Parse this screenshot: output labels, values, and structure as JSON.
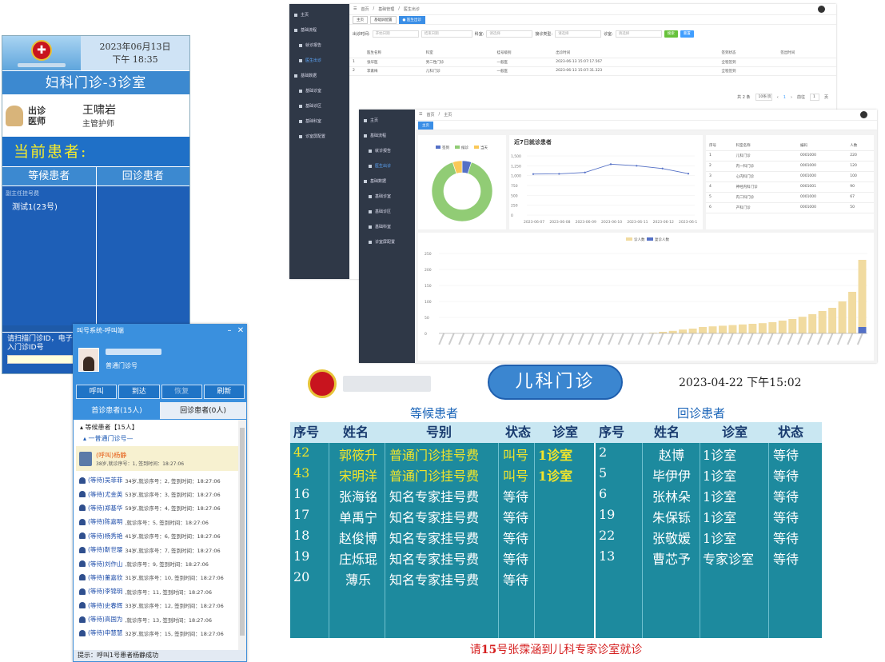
{
  "gyn": {
    "date": "2023年06月13日",
    "time": "下午 18:35",
    "title": "妇科门诊-3诊室",
    "doctor_label1": "出诊",
    "doctor_label2": "医师",
    "doctor_name": "王啸岩",
    "doctor_role": "主管护师",
    "current_label": "当前患者:",
    "waiting_head": "等候患者",
    "recheck_head": "回诊患者",
    "waiting_subtitle": "副主任挂号费",
    "waiting_patient": "测试1(23号)",
    "footer1": "请扫描门诊ID，电子",
    "footer2": "入门诊ID号"
  },
  "call": {
    "title": "叫号系统-呼叫端",
    "user_role": "普通门诊号",
    "buttons": [
      "呼叫",
      "到达",
      "恢复",
      "刷新"
    ],
    "tab_first": "首诊患者(15人)",
    "tab_recheck": "回诊患者(0人)",
    "group": "▴ 等候患者【15人】",
    "subgroup": "▴ 一普通门诊号—",
    "calling_name": "(呼叫)杨静",
    "calling_detail": "38岁,就诊序号：1, 签到时间：18:27:06",
    "rows": [
      {
        "name": "(等待)吴菲菲",
        "detail": "34岁,就诊序号：2, 签到时间：18:27:06"
      },
      {
        "name": "(等待)尤金英",
        "detail": "53岁,就诊序号：3, 签到时间：18:27:06"
      },
      {
        "name": "(等待)郑基华",
        "detail": "59岁,就诊序号：4, 签到时间：18:27:06"
      },
      {
        "name": "(等待)陈嘉明",
        "detail": ",就诊序号：5, 签到时间：18:27:06"
      },
      {
        "name": "(等待)杨秀艳",
        "detail": "41岁,就诊序号：6, 签到时间：18:27:06"
      },
      {
        "name": "(等待)靳世璎",
        "detail": "34岁,就诊序号：7, 签到时间：18:27:06"
      },
      {
        "name": "(等待)刘作山",
        "detail": ",就诊序号：9, 签到时间：18:27:06"
      },
      {
        "name": "(等待)董嘉欣",
        "detail": "31岁,就诊序号：10, 签到时间：18:27:06"
      },
      {
        "name": "(等待)李锦玥",
        "detail": ",就诊序号：11, 签到时间：18:27:06"
      },
      {
        "name": "(等待)史春辉",
        "detail": "33岁,就诊序号：12, 签到时间：18:27:06"
      },
      {
        "name": "(等待)高国为",
        "detail": ",就诊序号：13, 签到时间：18:27:06"
      },
      {
        "name": "(等待)申慧慧",
        "detail": "32岁,就诊序号：15, 签到时间：18:27:06"
      }
    ],
    "status": "提示：呼叫1号患者杨静成功"
  },
  "admin": {
    "sidebar": [
      "主页",
      "基础流程",
      "就诊报告",
      "医生出诊",
      "基础数据",
      "基础诊室",
      "基础诊区",
      "基础科室",
      "诊室屏配置"
    ],
    "breadcrumb": [
      "首页",
      "基础管理",
      "医生出诊"
    ],
    "tags": [
      "主页",
      "基础屏配置",
      "● 医生出诊"
    ],
    "filters": {
      "date_label": "出诊时间:",
      "start": "开始日期",
      "end": "结束日期",
      "dept_label": "科室:",
      "dept": "请选择",
      "type_label": "接诊类型:",
      "type": "请选择",
      "room_label": "诊室:",
      "room": "请选择",
      "search": "搜索",
      "reset": "重置"
    },
    "columns": [
      "医生名称",
      "科室",
      "挂号级别",
      "出诊时间",
      "签到状态",
      "签出时间"
    ],
    "rows": [
      [
        "1",
        "张华医",
        "男二性门诊",
        "一般医",
        "2023-06-13 15:07:17.567",
        "",
        "全程签到"
      ],
      [
        "2",
        "李素梅",
        "儿科门诊",
        "一般医",
        "2023-06-13 15:07:31.323",
        "",
        "全程签到"
      ]
    ],
    "pager": {
      "total": "共 2 条",
      "size": "10条/页",
      "page": "1",
      "goto": "前往",
      "goto_page": "1",
      "unit": "页"
    }
  },
  "dash": {
    "sidebar": [
      "主页",
      "基础流程",
      "就诊报告",
      "医生出诊",
      "基础数据",
      "基础诊室",
      "基础诊区",
      "基础科室",
      "诊室屏配置"
    ],
    "breadcrumb": [
      "首页",
      "主页"
    ],
    "tag": "主页",
    "table_headers": [
      "序号",
      "科室名称",
      "编码",
      "人数"
    ],
    "table_rows": [
      [
        "1",
        "儿科门诊",
        "0001000",
        "220"
      ],
      [
        "2",
        "内一科门诊",
        "0001000",
        "120"
      ],
      [
        "3",
        "心内科门诊",
        "0001000",
        "100"
      ],
      [
        "4",
        "神经内科门诊",
        "0001001",
        "90"
      ],
      [
        "5",
        "内二科门诊",
        "0001000",
        "67"
      ],
      [
        "6",
        "产科门诊",
        "0001000",
        "50"
      ]
    ]
  },
  "chart_data": [
    {
      "type": "pie",
      "labels": [
        "签到",
        "候诊",
        "当天"
      ],
      "values": [
        5,
        90,
        5
      ],
      "colors": [
        "#5470c6",
        "#91cc75",
        "#fac858"
      ]
    },
    {
      "type": "line",
      "title": "近7日就诊患者",
      "x": [
        "2023-06-07",
        "2023-06-08",
        "2023-06-09",
        "2023-06-10",
        "2023-06-11",
        "2023-06-12",
        "2023-06-1"
      ],
      "y": [
        1040,
        1045,
        1080,
        1290,
        1250,
        1180,
        1050
      ],
      "yticks": [
        "1,500",
        "1,250",
        "1,000",
        "750",
        "500",
        "250",
        "0"
      ],
      "ylim": [
        0,
        1500
      ]
    },
    {
      "type": "bar",
      "series": [
        {
          "name": "诊人数",
          "color": "#f1dba0",
          "values": [
            0,
            0,
            0,
            0,
            0,
            0,
            0,
            0,
            0,
            0,
            0,
            0,
            0,
            0,
            0,
            0,
            0,
            0,
            0,
            0,
            0,
            2,
            5,
            8,
            12,
            15,
            20,
            22,
            24,
            26,
            28,
            30,
            32,
            35,
            40,
            45,
            52,
            60,
            70,
            80,
            100,
            130,
            230
          ]
        },
        {
          "name": "复诊人数",
          "color": "#5470c6",
          "values": [
            0,
            0,
            0,
            0,
            0,
            0,
            0,
            0,
            0,
            0,
            0,
            0,
            0,
            0,
            0,
            0,
            0,
            0,
            0,
            0,
            0,
            0,
            0,
            0,
            0,
            0,
            0,
            0,
            0,
            0,
            0,
            0,
            0,
            0,
            0,
            0,
            0,
            0,
            0,
            0,
            0,
            0,
            20
          ]
        }
      ],
      "yticks": [
        "250",
        "200",
        "150",
        "100",
        "50",
        "0"
      ],
      "ylim": [
        0,
        250
      ]
    }
  ],
  "peds": {
    "title": "儿科门诊",
    "datetime": "2023-04-22 下午15:02",
    "waiting_section": "等候患者",
    "recheck_section": "回诊患者",
    "left_headers": [
      "序号",
      "姓名",
      "号别",
      "状态",
      "诊室"
    ],
    "right_headers": [
      "序号",
      "姓名",
      "诊室",
      "状态"
    ],
    "left_rows": [
      {
        "no": "42",
        "name": "郭筱升",
        "type": "普通门诊挂号费",
        "state": "叫号",
        "room": "1诊室",
        "hl": true
      },
      {
        "no": "43",
        "name": "宋明洋",
        "type": "普通门诊挂号费",
        "state": "叫号",
        "room": "1诊室",
        "hl": true
      },
      {
        "no": "16",
        "name": "张海铭",
        "type": "知名专家挂号费",
        "state": "等待",
        "room": "",
        "hl": false
      },
      {
        "no": "17",
        "name": "单禹宁",
        "type": "知名专家挂号费",
        "state": "等待",
        "room": "",
        "hl": false
      },
      {
        "no": "18",
        "name": "赵俊博",
        "type": "知名专家挂号费",
        "state": "等待",
        "room": "",
        "hl": false
      },
      {
        "no": "19",
        "name": "庄烁琨",
        "type": "知名专家挂号费",
        "state": "等待",
        "room": "",
        "hl": false
      },
      {
        "no": "20",
        "name": "薄乐",
        "type": "知名专家挂号费",
        "state": "等待",
        "room": "",
        "hl": false
      }
    ],
    "right_rows": [
      {
        "no": "2",
        "name": "赵博",
        "room": "1诊室",
        "state": "等待"
      },
      {
        "no": "5",
        "name": "毕伊伊",
        "room": "1诊室",
        "state": "等待"
      },
      {
        "no": "6",
        "name": "张林朵",
        "room": "1诊室",
        "state": "等待"
      },
      {
        "no": "19",
        "name": "朱保铄",
        "room": "1诊室",
        "state": "等待"
      },
      {
        "no": "22",
        "name": "张敬媛",
        "room": "1诊室",
        "state": "等待"
      },
      {
        "no": "13",
        "name": "曹芯予",
        "room": "专家诊室",
        "state": "等待"
      }
    ],
    "message_pre": "请",
    "message_num": "15",
    "message_post": "号张霂涵到儿科专家诊室就诊"
  }
}
